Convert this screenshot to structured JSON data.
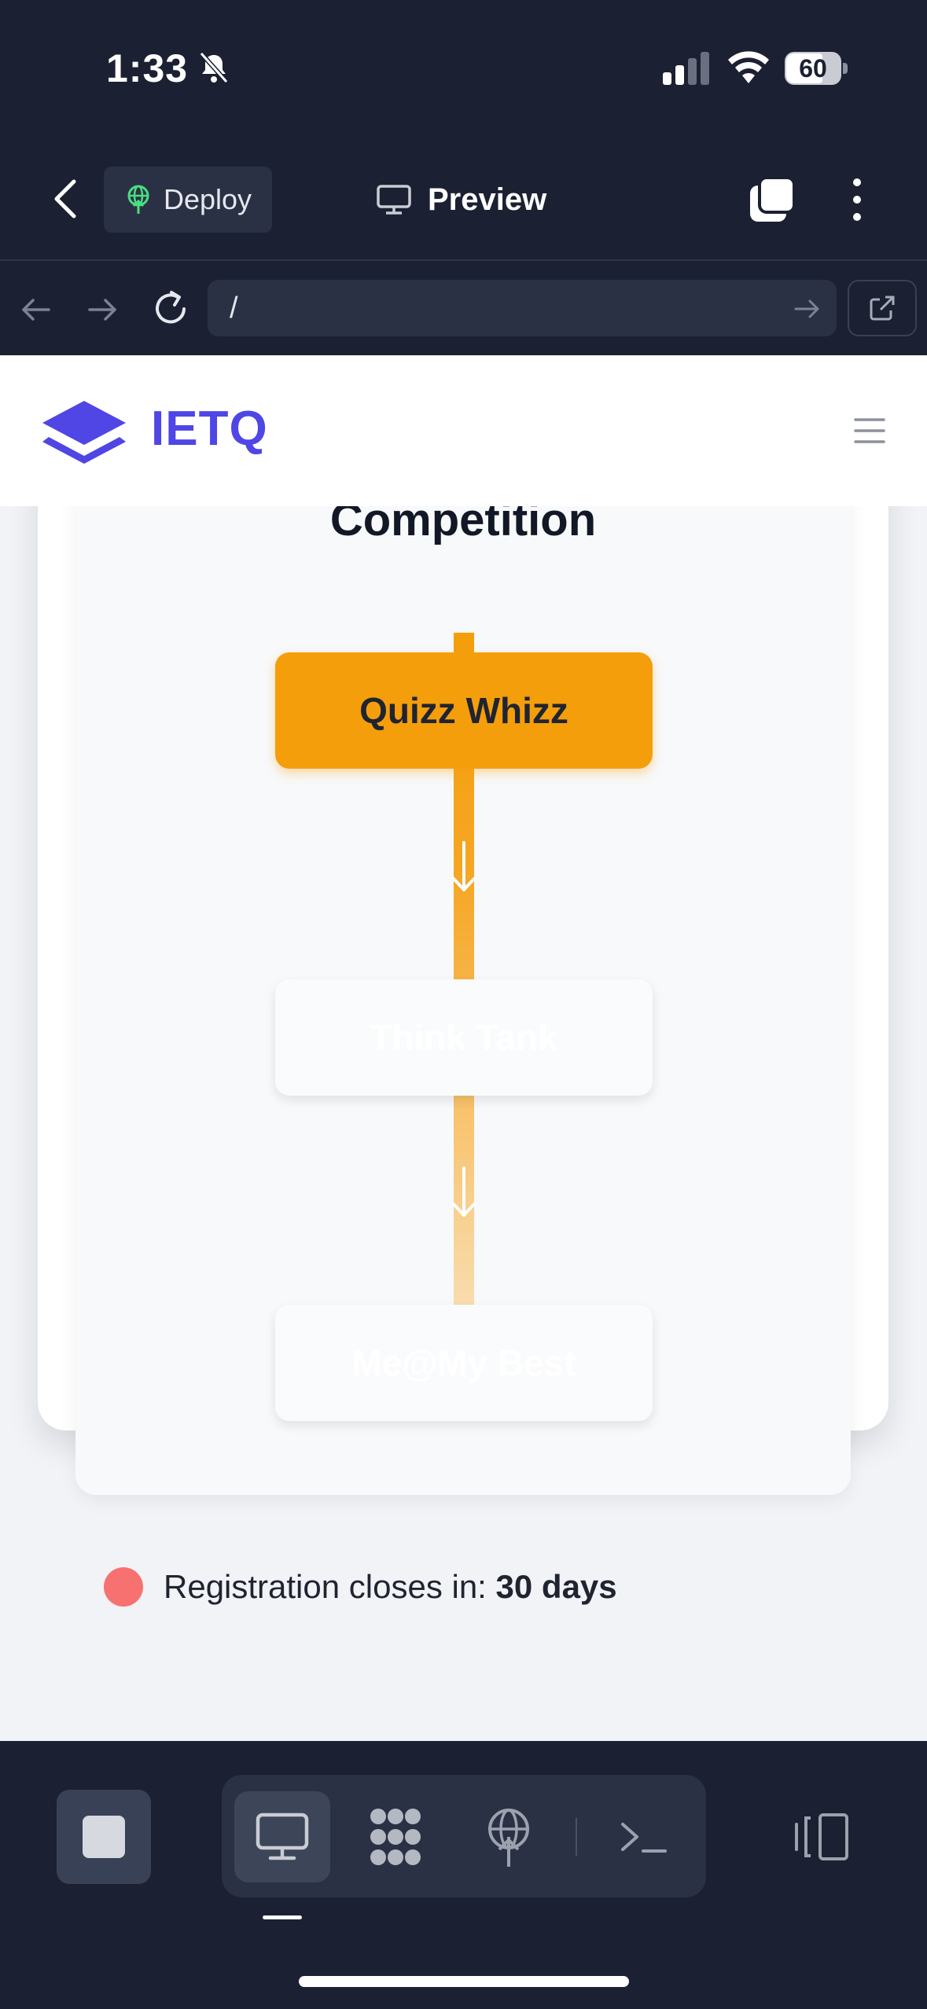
{
  "status_bar": {
    "time": "1:33",
    "battery_level": "60"
  },
  "app_toolbar": {
    "deploy_label": "Deploy",
    "preview_label": "Preview"
  },
  "address_bar": {
    "url": "/"
  },
  "site": {
    "logo_text": "IETQ",
    "competition_heading": "Competition",
    "stages": [
      {
        "label": "Quizz Whizz",
        "active": true
      },
      {
        "label": "Think Tank",
        "active": false
      },
      {
        "label": "Me@My Best",
        "active": false
      }
    ],
    "registration": {
      "prefix": "Registration closes in:",
      "days": "30 days"
    }
  },
  "colors": {
    "accent_orange": "#f59e0b",
    "brand_indigo": "#4f46e5",
    "status_red": "#f87171",
    "chrome_bg": "#1b2032"
  }
}
